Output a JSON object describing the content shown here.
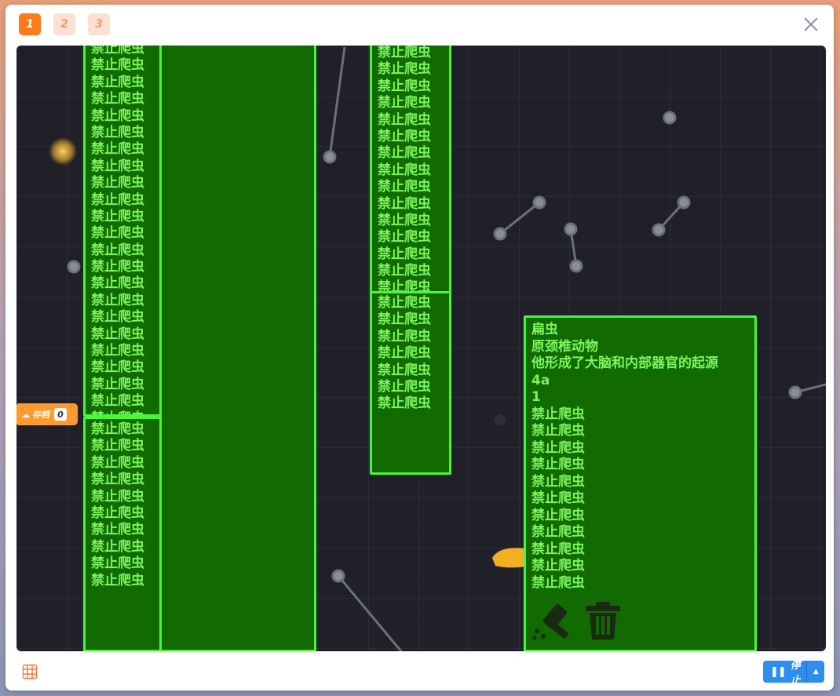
{
  "tabs": [
    "1",
    "2",
    "3"
  ],
  "save_badge": {
    "label": "存档",
    "count": "0"
  },
  "stop_button": {
    "label": "停止"
  },
  "repeat_text": "禁止爬虫",
  "left_col_top_count": 23,
  "left_col_bottom_count": 10,
  "mid_col_top_count": 15,
  "mid_col_bottom_count": 7,
  "info_panel": {
    "lines": [
      "扁虫",
      "原颈椎动物",
      "他形成了大脑和内部器官的起源",
      "4a",
      "1"
    ],
    "repeat_count": 11
  },
  "icons": [
    "hammer-icon",
    "trash-icon",
    "grid-icon",
    "close-icon",
    "pause-icon",
    "caret-up-icon"
  ],
  "colors": {
    "panel_bg": "#116b00",
    "panel_border": "#4cf53a",
    "panel_text": "#7cf55e",
    "accent": "#ff7a1a",
    "button": "#2d8ef0"
  }
}
